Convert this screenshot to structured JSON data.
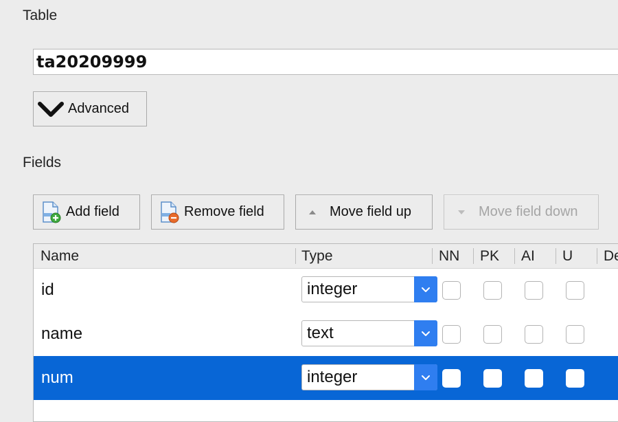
{
  "table_section": {
    "label": "Table",
    "name_value": "ta20209999"
  },
  "advanced_button": {
    "label": "Advanced",
    "icon": "chevron-down-icon"
  },
  "fields_section": {
    "label": "Fields"
  },
  "toolbar": {
    "add_field": "Add field",
    "remove_field": "Remove field",
    "move_up": "Move field up",
    "move_down": "Move field down"
  },
  "columns": [
    "Name",
    "Type",
    "NN",
    "PK",
    "AI",
    "U",
    "De"
  ],
  "rows": [
    {
      "name": "id",
      "type": "integer",
      "nn": false,
      "pk": false,
      "ai": false,
      "u": false,
      "selected": false
    },
    {
      "name": "name",
      "type": "text",
      "nn": false,
      "pk": false,
      "ai": false,
      "u": false,
      "selected": false
    },
    {
      "name": "num",
      "type": "integer",
      "nn": false,
      "pk": false,
      "ai": false,
      "u": false,
      "selected": true
    }
  ],
  "colors": {
    "selection": "#0866d6",
    "select_arrow": "#2f7ef0",
    "disabled_text": "#a5a5a5"
  }
}
